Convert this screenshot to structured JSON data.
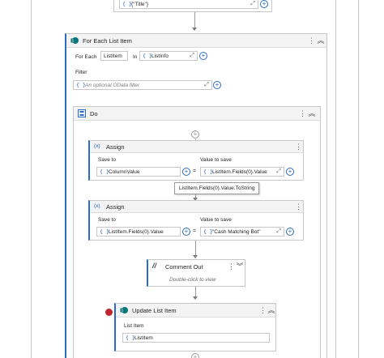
{
  "top_activity": {
    "field_value": "{\"Title\"}"
  },
  "for_each": {
    "title": "For Each List Item",
    "for_each_label": "For Each",
    "item_name": "ListItem",
    "in_label": "In",
    "list_value": "ListInfo",
    "filter_label": "Filter",
    "filter_placeholder": "An optional OData filter"
  },
  "do": {
    "title": "Do"
  },
  "assign1": {
    "title": "Assign",
    "save_to_label": "Save to",
    "value_label": "Value to save",
    "save_to_value": "ColumnValue",
    "value_value": "ListItem.Fields(0).Value",
    "tooltip": "ListItem.Fields(0).Value.ToString"
  },
  "assign2": {
    "title": "Assign",
    "save_to_label": "Save to",
    "value_label": "Value to save",
    "save_to_value": "ListItem.Fields(0).Value",
    "value_value": "\"Cash Matching Bot\""
  },
  "comment_out": {
    "title": "Comment Out",
    "hint": "Double-click to view"
  },
  "update_item": {
    "title": "Update List Item",
    "list_item_label": "List Item",
    "list_item_value": "ListItem"
  },
  "glyphs": {
    "brace": "{ }",
    "kebab": "⋮",
    "collapse": "︽",
    "expand": "︾",
    "expand_arrows": "⤢",
    "plus": "+",
    "equals": "=",
    "assign_icon": "(x)",
    "comment_icon": "//"
  },
  "colors": {
    "accent": "#2b6cc4",
    "error": "#c0272d",
    "sharepoint": "#03787c"
  }
}
